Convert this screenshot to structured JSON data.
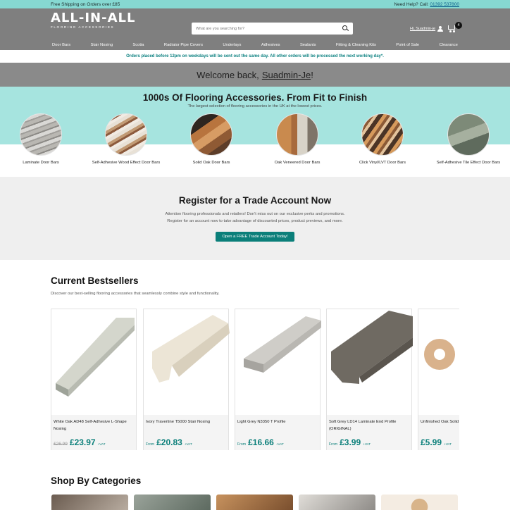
{
  "topbar": {
    "shipping": "Free Shipping on Orders over £85",
    "help": "Need Help? Call:",
    "phone": "01392 537800"
  },
  "header": {
    "logo_main": "ALL-IN-ALL",
    "logo_sub": "FLOORING ACCESSORIES",
    "search_placeholder": "What are you searching for?",
    "account_label": "Hi, Suadmin-je",
    "cart_count": "4"
  },
  "nav": [
    "Door Bars",
    "Stair Nosing",
    "Scotia",
    "Radiator Pipe Covers",
    "Underlays",
    "Adhesives",
    "Sealants",
    "Fitting & Cleaning Kits",
    "Point of Sale",
    "Clearance"
  ],
  "notice": "Orders placed before 12pm on weekdays will be sent out the same day. All other orders will be processed the next working day*.",
  "welcome": {
    "text": "Welcome back,",
    "user": "Suadmin-Je",
    "suffix": "!"
  },
  "hero": {
    "title": "1000s Of Flooring Accessories. From Fit to Finish",
    "subtitle": "The largest selection of flooring accessories in the UK at the lowest prices.",
    "categories": [
      {
        "label": "Laminate Door Bars"
      },
      {
        "label": "Self-Adhesive Wood Effect Door Bars"
      },
      {
        "label": "Solid Oak Door Bars"
      },
      {
        "label": "Oak Veneered Door Bars"
      },
      {
        "label": "Click Vinyl/LVT Door Bars"
      },
      {
        "label": "Self-Adhesive Tile Effect Door Bars"
      }
    ]
  },
  "trade": {
    "title": "Register for a Trade Account Now",
    "text": "Attention flooring professionals and retailers! Don't miss out on our exclusive perks and promotions. Register for an account now to take advantage of discounted prices, product previews, and more.",
    "button": "Open a FREE Trade Account Today!"
  },
  "bestsellers": {
    "title": "Current Bestsellers",
    "desc": "Discover our best-selling flooring accessories that seamlessly combine style and functionality.",
    "products": [
      {
        "title": "White Oak AD48 Self-Adhesive L-Shape Nosing",
        "from": "",
        "was": "£26.99",
        "price": "£23.97",
        "vat": "+VAT"
      },
      {
        "title": "Ivory Travertine T5000 Stair Nosing",
        "from": "From",
        "was": "",
        "price": "£20.83",
        "vat": "+VAT"
      },
      {
        "title": "Light Grey N3350 T Profile",
        "from": "From",
        "was": "",
        "price": "£16.66",
        "vat": "+VAT"
      },
      {
        "title": "Soft Grey LD14 Laminate End Profile (ORIGINAL)",
        "from": "From",
        "was": "",
        "price": "£3.99",
        "vat": "+VAT"
      },
      {
        "title": "Unfinished Oak Solid Pipe Rose Covers",
        "from": "",
        "was": "",
        "price": "£5.99",
        "vat": "+VAT"
      }
    ]
  },
  "shop": {
    "title": "Shop By Categories"
  },
  "colors": {
    "accent": "#0b7f7a",
    "topbar": "#86d9d2",
    "header": "#7f7f7f",
    "hero_band": "#a6e4df"
  }
}
